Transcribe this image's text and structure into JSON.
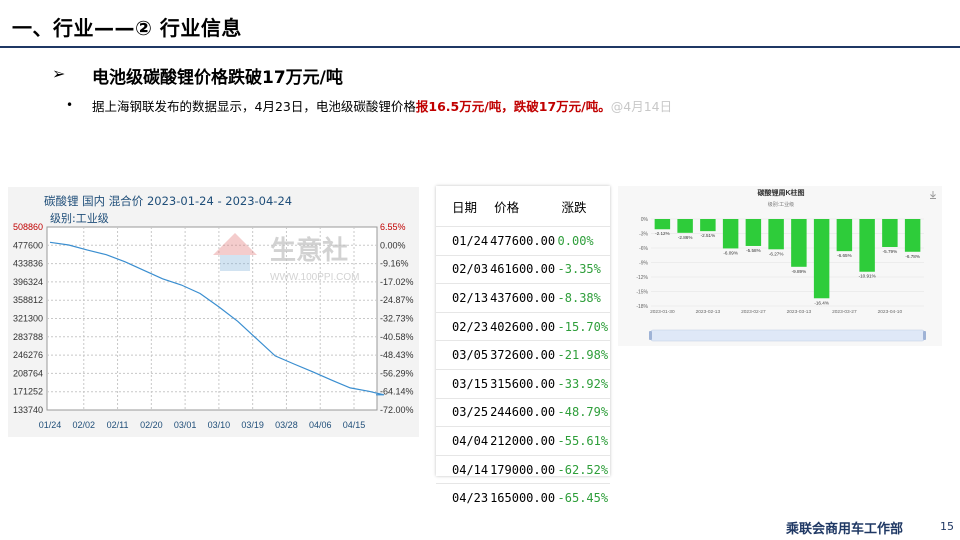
{
  "header": {
    "title": "一、行业——② 行业信息"
  },
  "section": {
    "arrow": "➢",
    "heading": "电池级碳酸锂价格跌破17万元/吨"
  },
  "bullet": {
    "dot": "•",
    "text_plain": "据上海钢联发布的数据显示，4月23日，电池级碳酸锂价格",
    "text_red": "报16.5万元/吨，跌破17万元/吨。",
    "text_faint": "@4月14日"
  },
  "footer": {
    "org": "乘联会商用车工作部",
    "page": "15"
  },
  "chart_data": [
    {
      "type": "line",
      "title": "碳酸锂 国内 混合价 2023-01-24 - 2023-04-24",
      "subtitle": "级别:工业级",
      "watermark": "生意社",
      "watermark_url": "WWW.100PPI.COM",
      "y_ticks_left": [
        "508860",
        "477600",
        "433836",
        "396324",
        "358812",
        "321300",
        "283788",
        "246276",
        "208764",
        "171252",
        "133740"
      ],
      "y_ticks_right": [
        "6.55%",
        "0.00%",
        "-9.16%",
        "-17.02%",
        "-24.87%",
        "-32.73%",
        "-40.58%",
        "-48.43%",
        "-56.29%",
        "-64.14%",
        "-72.00%"
      ],
      "x_ticks": [
        "01/24",
        "02/02",
        "02/11",
        "02/20",
        "03/01",
        "03/10",
        "03/19",
        "03/28",
        "04/06",
        "04/15"
      ],
      "ylim": [
        133740,
        508860
      ],
      "series": [
        {
          "x": [
            "01/24",
            "01/29",
            "02/03",
            "02/08",
            "02/13",
            "02/18",
            "02/23",
            "02/28",
            "03/05",
            "03/10",
            "03/15",
            "03/20",
            "03/25",
            "03/30",
            "04/04",
            "04/09",
            "04/14",
            "04/19",
            "04/23"
          ],
          "values": [
            477600,
            472000,
            461600,
            452000,
            437600,
            420000,
            402600,
            390000,
            372600,
            345000,
            315600,
            280000,
            244600,
            228000,
            212000,
            195000,
            179000,
            172000,
            165000
          ]
        }
      ],
      "colors": {
        "line": "#3a8ed0",
        "y_left_top": "#c00000",
        "y_right_top": "#c00000"
      }
    },
    {
      "type": "table",
      "columns": [
        "日期",
        "价格",
        "涨跌"
      ],
      "rows": [
        [
          "01/24",
          "477600.00",
          "0.00%"
        ],
        [
          "02/03",
          "461600.00",
          "-3.35%"
        ],
        [
          "02/13",
          "437600.00",
          "-8.38%"
        ],
        [
          "02/23",
          "402600.00",
          "-15.70%"
        ],
        [
          "03/05",
          "372600.00",
          "-21.98%"
        ],
        [
          "03/15",
          "315600.00",
          "-33.92%"
        ],
        [
          "03/25",
          "244600.00",
          "-48.79%"
        ],
        [
          "04/04",
          "212000.00",
          "-55.61%"
        ],
        [
          "04/14",
          "179000.00",
          "-62.52%"
        ],
        [
          "04/23",
          "165000.00",
          "-65.45%"
        ]
      ]
    },
    {
      "type": "bar",
      "title": "碳酸锂周K柱图",
      "subtitle": "级别:工业级",
      "y_ticks": [
        "0%",
        "-3%",
        "-6%",
        "-9%",
        "-12%",
        "-15%",
        "-18%"
      ],
      "ylim": [
        -18,
        0
      ],
      "x_ticks": [
        "2023-01-30",
        "2023-02-13",
        "2023-02-27",
        "2023-03-13",
        "2023-03-27",
        "2023-04-10"
      ],
      "values": [
        -2.12,
        -2.86,
        -2.51,
        -6.09,
        -5.58,
        -6.27,
        -9.89,
        -16.4,
        -6.65,
        -10.91,
        -5.79,
        -6.78
      ],
      "labels": [
        "-2.12%",
        "-2.86%",
        "-2.51%",
        "-6.09%",
        "-5.58%",
        "-6.27%",
        "-9.89%",
        "-16.4%",
        "-6.65%",
        "-10.91%",
        "-5.79%",
        "-6.78%"
      ],
      "colors": {
        "bar": "#2ecc3a"
      }
    }
  ]
}
